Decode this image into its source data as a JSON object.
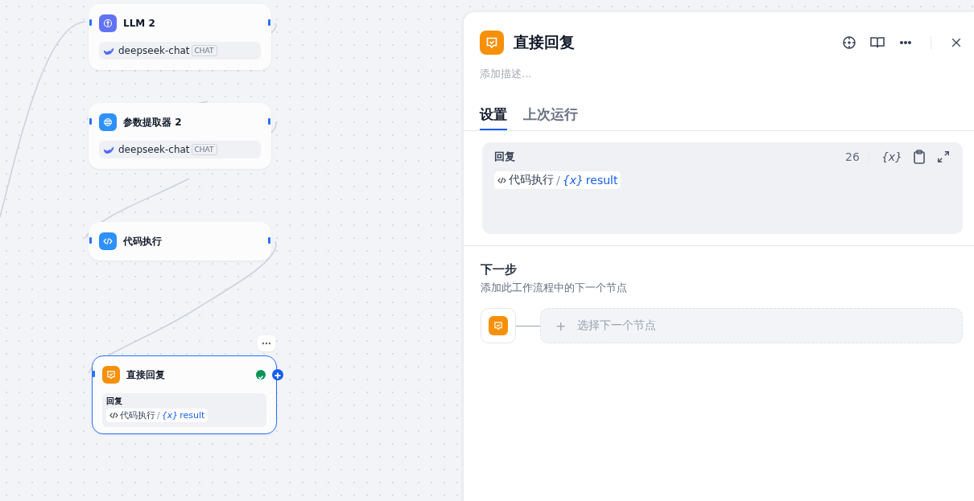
{
  "canvas": {
    "nodes": [
      {
        "kind": "llm",
        "title": "LLM 2",
        "model": "deepseek-chat",
        "model_tag": "CHAT",
        "selected": false
      },
      {
        "kind": "parameter",
        "title": "参数提取器 2",
        "model": "deepseek-chat",
        "model_tag": "CHAT",
        "selected": false
      },
      {
        "kind": "code",
        "title": "代码执行",
        "selected": false
      },
      {
        "kind": "answer",
        "title": "直接回复",
        "selected": true,
        "succeeded": true,
        "field_label": "回复",
        "variable": {
          "node": "代码执行",
          "separator": "/",
          "var_mark": "{x}",
          "name": "result"
        }
      }
    ]
  },
  "panel": {
    "title": "直接回复",
    "description_placeholder": "添加描述...",
    "tabs": [
      {
        "label": "设置",
        "selected": true
      },
      {
        "label": "上次运行",
        "selected": false
      }
    ],
    "reply": {
      "label": "回复",
      "count": "26",
      "var_button": "{x}",
      "variable": {
        "node": "代码执行",
        "separator": "/",
        "var_mark": "{x}",
        "name": "result"
      }
    },
    "next_step": {
      "title": "下一步",
      "subtitle": "添加此工作流程中的下一个节点",
      "plus": "+",
      "add_label": "选择下一个节点"
    }
  }
}
